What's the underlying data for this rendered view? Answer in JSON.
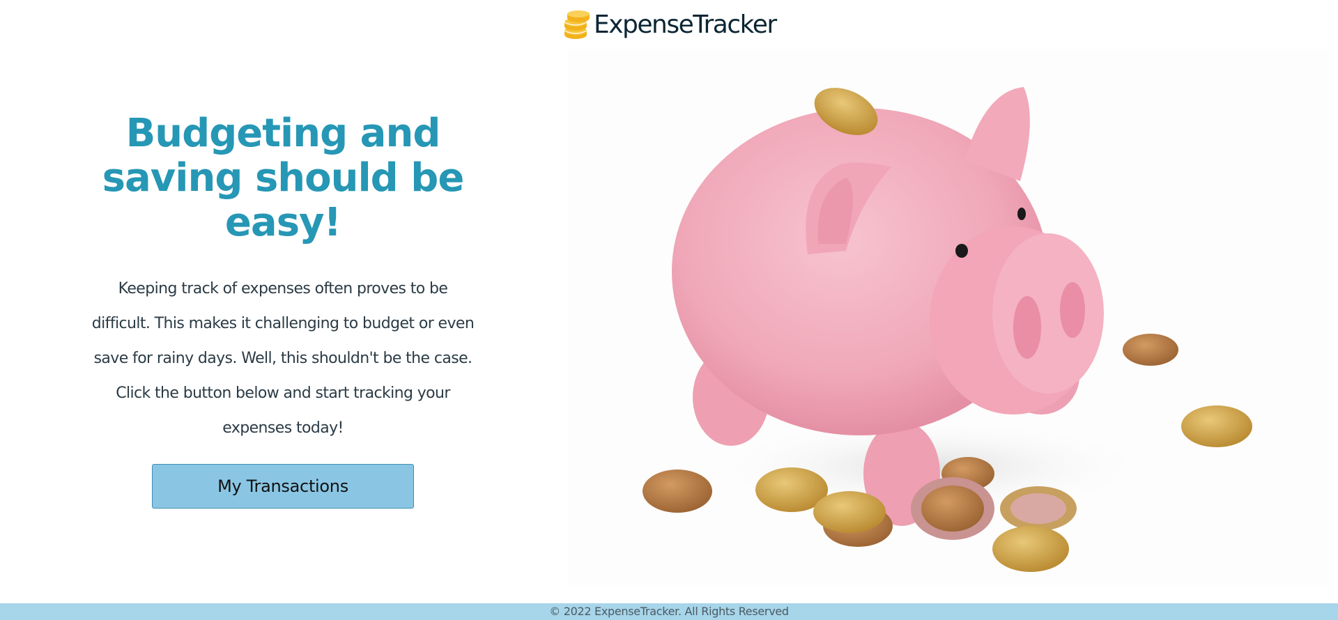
{
  "header": {
    "logo_icon": "stacked-coins-icon",
    "logo_text": "ExpenseTracker"
  },
  "hero": {
    "title_line1": "Budgeting and",
    "title_line2": "saving should be",
    "title_line3": "easy!",
    "description": "Keeping track of expenses often proves to be difficult. This makes it challenging to budget or even save for rainy days. Well, this shouldn't be the case. Click the button below and start tracking your expenses today!",
    "cta_label": "My Transactions",
    "image_subject": "piggy-bank-with-coins-image"
  },
  "footer": {
    "copyright": "© 2022 ExpenseTracker. All Rights Reserved"
  },
  "colors": {
    "accent": "#2697b5",
    "button_bg": "#8ac6e4",
    "footer_bg": "#a7d5ea",
    "logo_coin": "#f2b21c",
    "logo_text": "#0b2533"
  }
}
